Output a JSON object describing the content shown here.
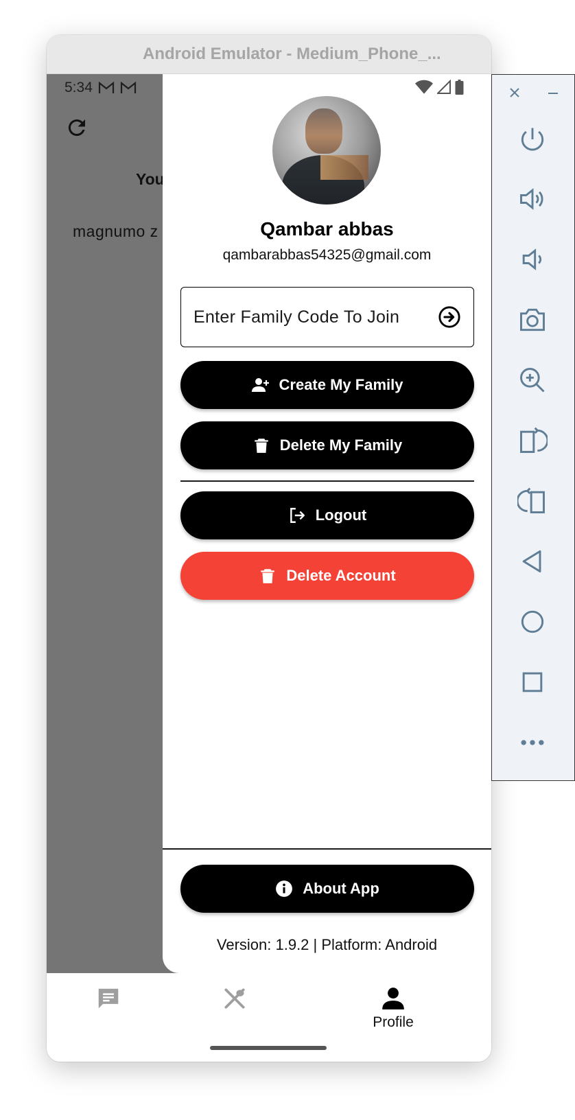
{
  "window": {
    "title": "Android Emulator - Medium_Phone_..."
  },
  "status_bar": {
    "time": "5:34"
  },
  "background": {
    "heading_partial": "You",
    "item_partial": "magnumo z"
  },
  "drawer": {
    "user_name": "Qambar abbas",
    "user_email": "qambarabbas54325@gmail.com",
    "family_code": {
      "placeholder": "Enter Family Code To Join",
      "value": ""
    },
    "buttons": {
      "create_family": "Create My Family",
      "delete_family": "Delete My Family",
      "logout": "Logout",
      "delete_account": "Delete Account",
      "about_app": "About App"
    },
    "version_text": "Version: 1.9.2 | Platform: Android"
  },
  "bottom_nav": {
    "items": [
      {
        "icon": "chat-icon",
        "label": ""
      },
      {
        "icon": "utensils-icon",
        "label": ""
      },
      {
        "icon": "person-icon",
        "label": "Profile"
      }
    ]
  },
  "emulator_toolbar": {
    "buttons": [
      "close-icon",
      "minimize-icon",
      "power-icon",
      "volume-up-icon",
      "volume-down-icon",
      "camera-icon",
      "zoom-in-icon",
      "rotate-left-icon",
      "rotate-right-icon",
      "back-icon",
      "home-icon",
      "overview-icon",
      "more-icon"
    ]
  },
  "colors": {
    "primary_button": "#000000",
    "danger_button": "#f44336",
    "scrim": "#757575",
    "toolbar_icon": "#5f7d95"
  }
}
